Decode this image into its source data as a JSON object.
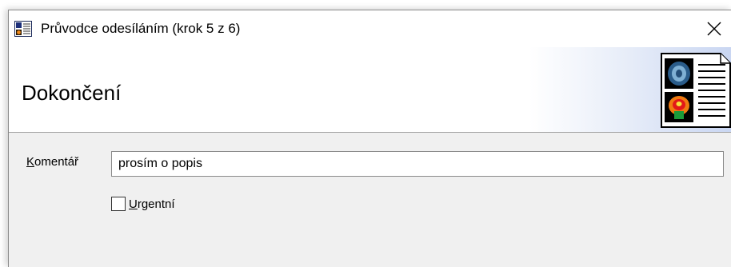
{
  "window": {
    "title": "Průvodce odesíláním (krok 5 z 6)",
    "app_icon": "document-icon",
    "close_icon": "close-icon"
  },
  "header": {
    "title": "Dokončení",
    "image_icon": "medical-document-icon"
  },
  "form": {
    "comment_label_mnemonic": "K",
    "comment_label_rest": "omentář",
    "comment_value": "prosím o popis",
    "urgent_label_mnemonic": "U",
    "urgent_label_rest": "rgentní",
    "urgent_checked": false
  }
}
